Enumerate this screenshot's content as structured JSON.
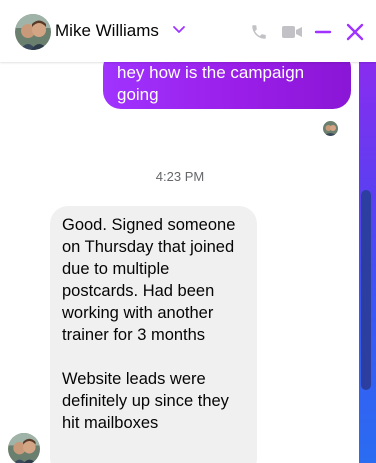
{
  "header": {
    "contact_name": "Mike Williams",
    "avatar_icon": "profile-photo",
    "actions": [
      "phone-icon",
      "video-icon",
      "minimize-icon",
      "close-icon"
    ],
    "accent_color": "#a033ff"
  },
  "messages": {
    "outgoing": {
      "text": "hey how is the campaign going"
    },
    "timestamp": "4:23 PM",
    "incoming": {
      "text": "Good.  Signed someone on Thursday that joined due to multiple postcards. Had been working with another trainer for 3 months\n\nWebsite leads were definitely up since they hit mailboxes"
    }
  }
}
